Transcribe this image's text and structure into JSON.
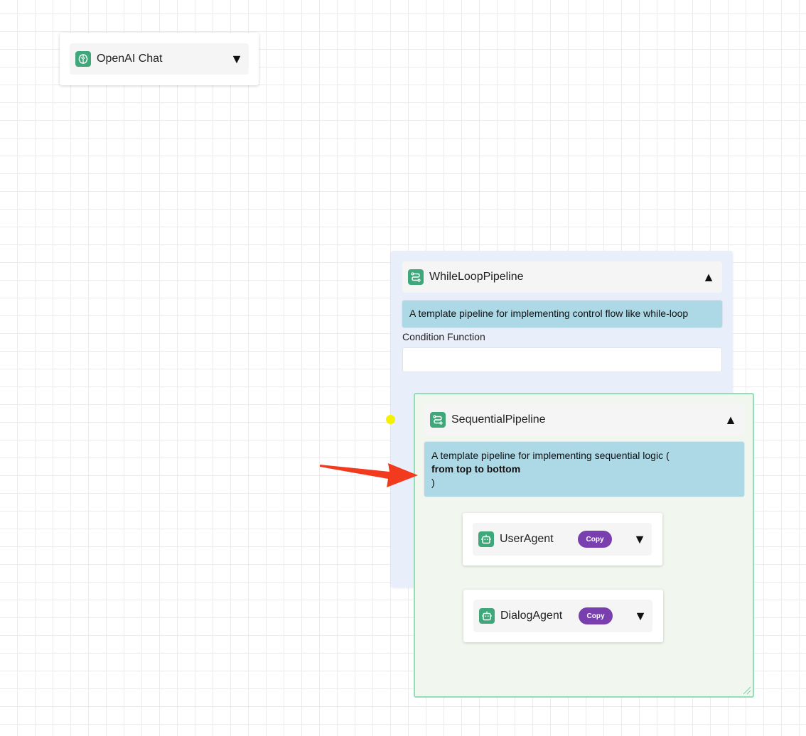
{
  "openai_node": {
    "title": "OpenAI Chat",
    "icon": "brain-icon",
    "toggle": "▼"
  },
  "while_loop": {
    "title": "WhileLoopPipeline",
    "icon": "pipeline-icon",
    "toggle": "▲",
    "description": "A template pipeline for implementing control flow like while-loop",
    "condition_label": "Condition Function",
    "condition_value": ""
  },
  "sequential": {
    "title": "SequentialPipeline",
    "icon": "pipeline-icon",
    "toggle": "▲",
    "description_line1": "A template pipeline for implementing sequential logic (",
    "description_line2": "from top to bottom",
    "description_line3": ")"
  },
  "user_agent": {
    "title": "UserAgent",
    "icon": "robot-icon",
    "copy_label": "Copy",
    "toggle": "▼"
  },
  "dialog_agent": {
    "title": "DialogAgent",
    "icon": "robot-icon",
    "copy_label": "Copy",
    "toggle": "▼"
  },
  "colors": {
    "icon_green": "#3fa87a",
    "copy_purple": "#7a3fae",
    "desc_blue": "#add8e6",
    "while_bg": "#e9eefb",
    "seq_bg": "#f1f7ee",
    "seq_border": "#92dfb6",
    "connector": "#f4f200",
    "arrow": "#f23a1f"
  }
}
